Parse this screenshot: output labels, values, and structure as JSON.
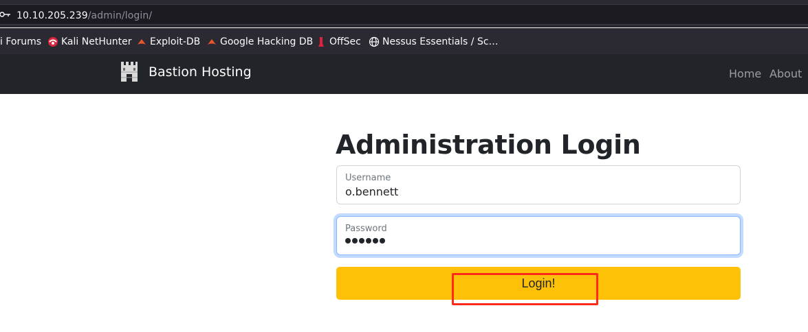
{
  "browser": {
    "url_host": "10.10.205.239",
    "url_path": "/admin/login/",
    "bookmarks": [
      {
        "label": "i Forums",
        "icon": "kali-icon"
      },
      {
        "label": "Kali NetHunter",
        "icon": "nethunter-icon"
      },
      {
        "label": "Exploit-DB",
        "icon": "exploit-db-icon"
      },
      {
        "label": "Google Hacking DB",
        "icon": "ghdb-icon"
      },
      {
        "label": "OffSec",
        "icon": "offsec-icon"
      },
      {
        "label": "Nessus Essentials / Sc…",
        "icon": "globe-icon"
      }
    ]
  },
  "navbar": {
    "brand": "Bastion Hosting",
    "links": [
      "Home",
      "About"
    ]
  },
  "main": {
    "title": "Administration Login",
    "username": {
      "label": "Username",
      "value": "o.bennett"
    },
    "password": {
      "label": "Password",
      "masked_length": 6
    },
    "login_label": "Login!"
  },
  "colors": {
    "navbar_bg": "#212529",
    "button_bg": "#ffc107",
    "highlight": "#ff2a1a"
  }
}
